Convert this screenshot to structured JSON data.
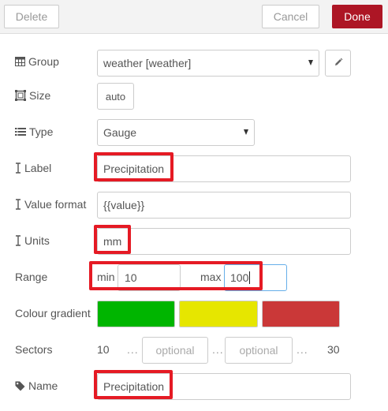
{
  "toolbar": {
    "delete_label": "Delete",
    "cancel_label": "Cancel",
    "done_label": "Done"
  },
  "form": {
    "group": {
      "label": "Group",
      "value": "weather [weather]",
      "icon": "table-icon"
    },
    "size": {
      "label": "Size",
      "value": "auto",
      "icon": "resize-icon"
    },
    "type": {
      "label": "Type",
      "value": "Gauge",
      "icon": "list-icon"
    },
    "label_field": {
      "label": "Label",
      "value": "Precipitation",
      "icon": "text-cursor-icon"
    },
    "value_format": {
      "label": "Value format",
      "value": "{{value}}",
      "icon": "text-cursor-icon"
    },
    "units": {
      "label": "Units",
      "value": "mm",
      "icon": "text-cursor-icon"
    },
    "range": {
      "label": "Range",
      "min_label": "min",
      "min_value": "10",
      "max_label": "max",
      "max_value": "100"
    },
    "colour_gradient": {
      "label": "Colour gradient",
      "colors": [
        "#00b500",
        "#e6e600",
        "#ca3838"
      ]
    },
    "sectors": {
      "label": "Sectors",
      "start": "10",
      "dots": "...",
      "placeholder_1": "optional",
      "placeholder_2": "optional",
      "end": "30"
    },
    "name": {
      "label": "Name",
      "value": "Precipitation",
      "icon": "tag-icon"
    }
  },
  "highlight_color": "#e51a24",
  "accent_color": "#ad1625"
}
